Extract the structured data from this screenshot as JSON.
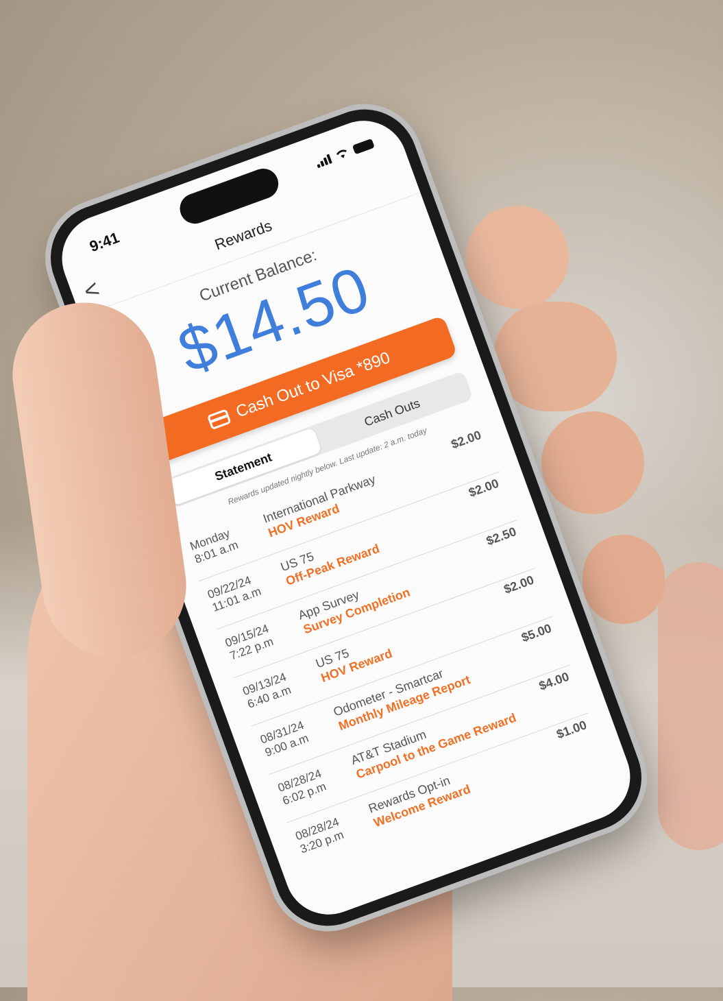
{
  "status_bar": {
    "time": "9:41"
  },
  "nav": {
    "title": "Rewards",
    "back_label": "<"
  },
  "balance": {
    "label": "Current Balance:",
    "amount": "$14.50"
  },
  "cash_out": {
    "label": "Cash Out to Visa *890",
    "icon": "credit-card-icon",
    "color": "#f36b22"
  },
  "tabs": [
    {
      "label": "Statement",
      "active": true
    },
    {
      "label": "Cash Outs",
      "active": false
    }
  ],
  "note": "Rewards updated nightly below. Last update: 2 a.m. today",
  "transactions": [
    {
      "date": "Monday",
      "time": "8:01 a.m",
      "location": "International Parkway",
      "reward": "HOV Reward",
      "amount": "$2.00"
    },
    {
      "date": "09/22/24",
      "time": "11:01 a.m",
      "location": "US 75",
      "reward": "Off-Peak Reward",
      "amount": "$2.00"
    },
    {
      "date": "09/15/24",
      "time": "7:22 p.m",
      "location": "App Survey",
      "reward": "Survey Completion",
      "amount": "$2.50"
    },
    {
      "date": "09/13/24",
      "time": "6:40 a.m",
      "location": "US 75",
      "reward": "HOV Reward",
      "amount": "$2.00"
    },
    {
      "date": "08/31/24",
      "time": "9:00 a.m",
      "location": "Odometer - Smartcar",
      "reward": "Monthly Mileage Report",
      "amount": "$5.00"
    },
    {
      "date": "08/28/24",
      "time": "6:02 p.m",
      "location": "AT&T Stadium",
      "reward": "Carpool to the Game Reward",
      "amount": "$4.00"
    },
    {
      "date": "08/28/24",
      "time": "3:20 p.m",
      "location": "Rewards Opt-in",
      "reward": "Welcome Reward",
      "amount": "$1.00"
    }
  ],
  "colors": {
    "balance": "#3f7fdb",
    "reward_text": "#f07024",
    "accent": "#f36b22"
  }
}
